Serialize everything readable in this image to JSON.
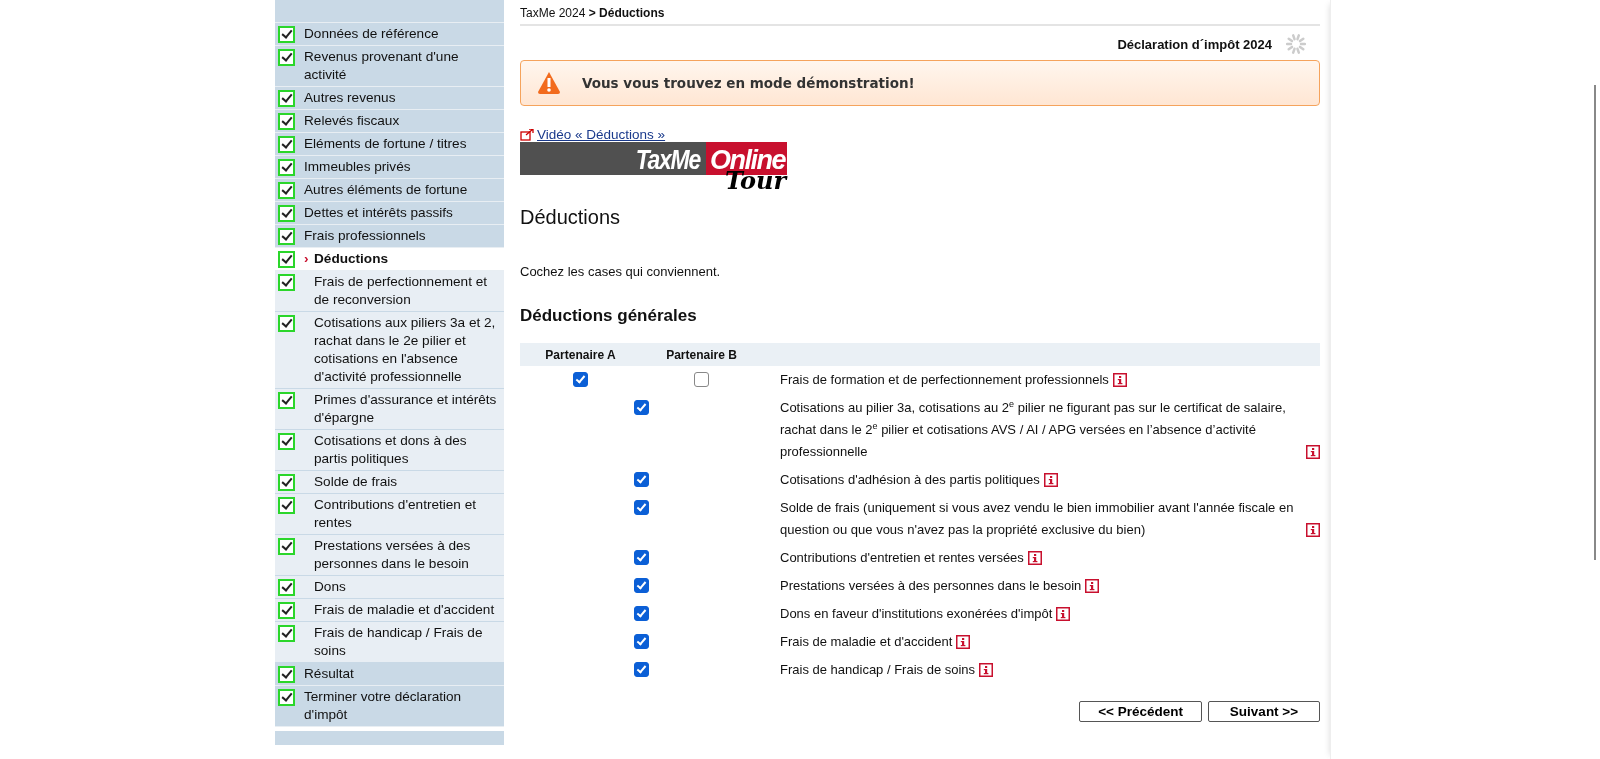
{
  "sidebar": {
    "items": [
      {
        "label": "Données de référence",
        "checked": true,
        "selected": false
      },
      {
        "label": "Revenus provenant d'une activité",
        "checked": true,
        "selected": false
      },
      {
        "label": "Autres revenus",
        "checked": true,
        "selected": false
      },
      {
        "label": "Relevés fiscaux",
        "checked": true,
        "selected": false
      },
      {
        "label": "Eléments de fortune / titres",
        "checked": true,
        "selected": false
      },
      {
        "label": "Immeubles privés",
        "checked": true,
        "selected": false
      },
      {
        "label": "Autres éléments de fortune",
        "checked": true,
        "selected": false
      },
      {
        "label": "Dettes et intérêts passifs",
        "checked": true,
        "selected": false
      },
      {
        "label": "Frais professionnels",
        "checked": true,
        "selected": false
      },
      {
        "label": "Déductions",
        "checked": true,
        "selected": true,
        "marker": "›",
        "children": [
          {
            "label": "Frais de perfectionnement et de reconversion",
            "checked": true,
            "selected": false
          },
          {
            "label": "Cotisations aux piliers 3a et 2, rachat dans le 2e pilier et cotisations en l'absence d'activité professionnelle",
            "checked": true,
            "selected": false
          },
          {
            "label": "Primes d'assurance et intérêts d'épargne",
            "checked": true,
            "selected": false
          },
          {
            "label": "Cotisations et dons à des partis politiques",
            "checked": true,
            "selected": false
          },
          {
            "label": "Solde de frais",
            "checked": true,
            "selected": false
          },
          {
            "label": "Contributions d'entretien et rentes",
            "checked": true,
            "selected": false
          },
          {
            "label": "Prestations versées à des personnes dans le besoin",
            "checked": true,
            "selected": false
          },
          {
            "label": "Dons",
            "checked": true,
            "selected": false
          },
          {
            "label": "Frais de maladie et d'accident",
            "checked": true,
            "selected": false
          },
          {
            "label": "Frais de handicap / Frais de soins",
            "checked": true,
            "selected": false
          }
        ]
      },
      {
        "label": "Résultat",
        "checked": true,
        "selected": false
      },
      {
        "label": "Terminer votre déclaration d'impôt",
        "checked": true,
        "selected": false
      }
    ]
  },
  "breadcrumb": {
    "root": "TaxMe 2024",
    "separator": ">",
    "current": "Déductions"
  },
  "declaration_title": "Déclaration d´impôt 2024",
  "alert": {
    "text": "Vous vous trouvez en mode démonstration!"
  },
  "video_link": "Vidéo « Déductions »",
  "logo": {
    "part_1": "TaxMe",
    "part_2": "Online",
    "part_3": "Tour"
  },
  "heading": "Déductions",
  "instruction": "Cochez les cases qui conviennent.",
  "section_title": "Déductions générales",
  "table": {
    "columns": [
      "Partenaire A",
      "Partenaire B"
    ],
    "rows": [
      {
        "kind": "pair",
        "a_checked": true,
        "b_checked": false,
        "label": "Frais de formation et de perfectionnement professionnels"
      },
      {
        "kind": "single",
        "checked": true,
        "label": "Cotisations au pilier 3a, cotisations au 2$^{e}$ pilier ne figurant pas sur le certificat de salaire, rachat dans le 2$^{e}$ pilier et cotisations AVS / AI / APG versées en l’absence d’activité professionnelle"
      },
      {
        "kind": "single",
        "checked": true,
        "label": "Cotisations d'adhésion à des partis politiques"
      },
      {
        "kind": "single",
        "checked": true,
        "label": "Solde de frais (uniquement si vous avez vendu le bien immobilier avant l'année fiscale en question ou que vous n'avez pas la propriété exclusive du bien)"
      },
      {
        "kind": "single",
        "checked": true,
        "label": "Contributions d'entretien et rentes versées"
      },
      {
        "kind": "single",
        "checked": true,
        "label": "Prestations versées à des personnes dans le besoin"
      },
      {
        "kind": "single",
        "checked": true,
        "label": "Dons en faveur d'institutions exonérées d'impôt"
      },
      {
        "kind": "single",
        "checked": true,
        "label": "Frais de maladie et d'accident"
      },
      {
        "kind": "single",
        "checked": true,
        "label": "Frais de handicap / Frais de soins"
      }
    ]
  },
  "buttons": [
    "<< Précédent",
    "Suivant >>"
  ]
}
